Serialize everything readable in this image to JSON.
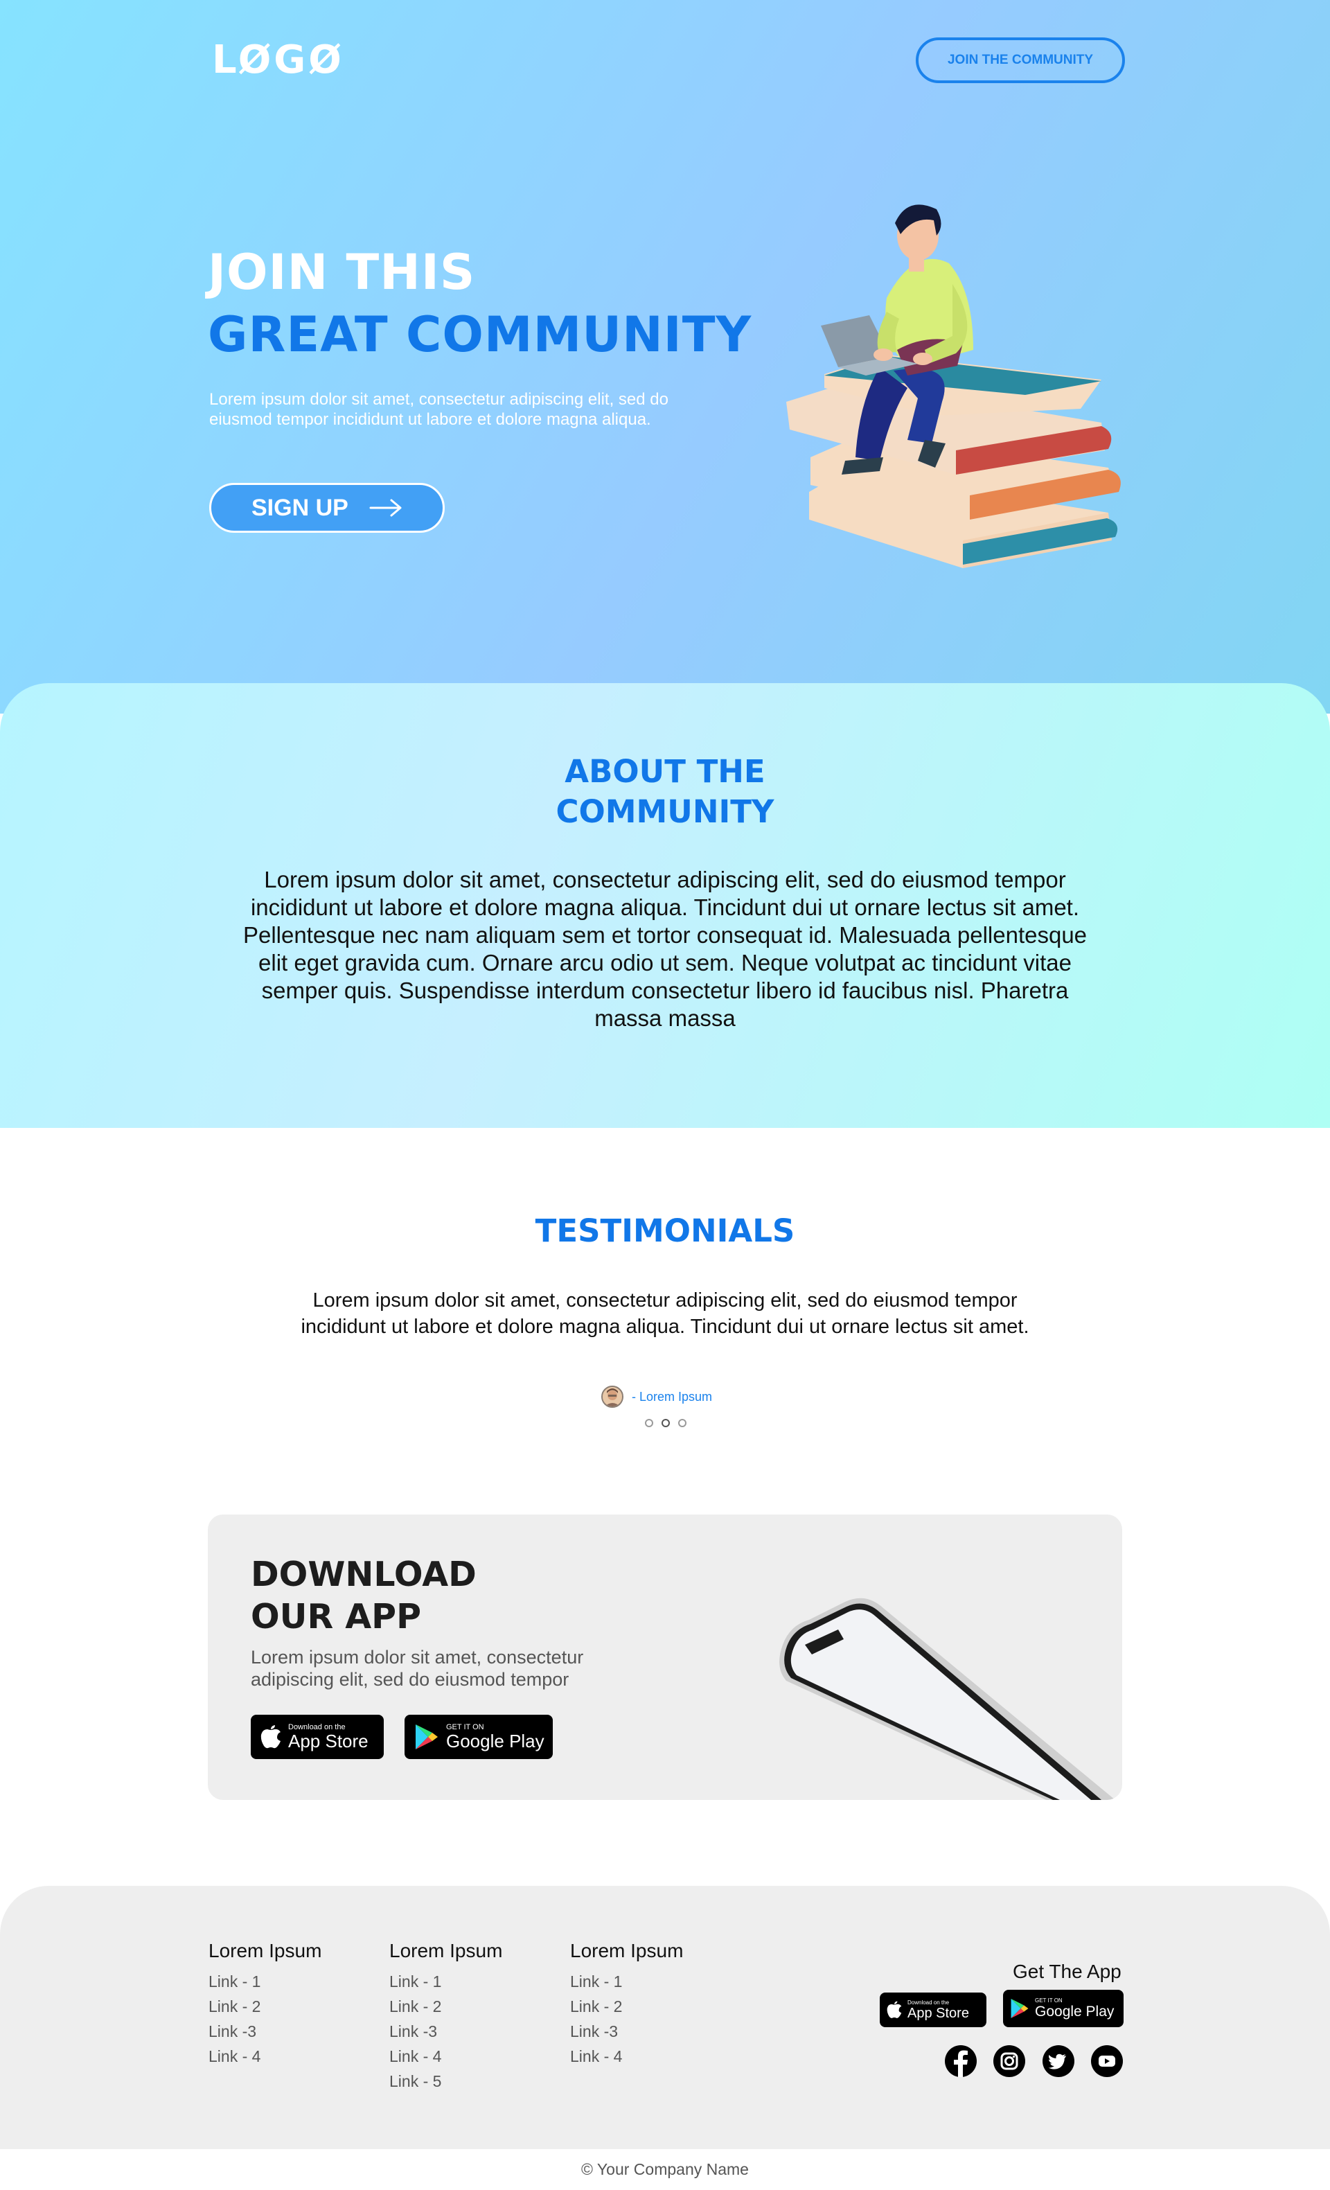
{
  "header": {
    "logo": "LØGØ",
    "join_button": "JOIN THE COMMUNITY"
  },
  "hero": {
    "title_line1": "JOIN THIS",
    "title_line2": "GREAT COMMUNITY",
    "description": "Lorem ipsum dolor sit amet, consectetur adipiscing elit, sed do eiusmod tempor incididunt ut labore et dolore magna aliqua.",
    "signup_label": "SIGN UP",
    "illustration_icon": "person-reading-on-books-illustration"
  },
  "about": {
    "title_line1": "ABOUT THE",
    "title_line2": "COMMUNITY",
    "text": "Lorem ipsum dolor sit amet, consectetur adipiscing elit, sed do eiusmod tempor incididunt ut labore et dolore magna aliqua. Tincidunt dui ut ornare lectus sit amet. Pellentesque nec nam aliquam sem et tortor consequat id. Malesuada pellentesque elit eget gravida cum. Ornare arcu odio ut sem. Neque volutpat ac tincidunt vitae semper quis. Suspendisse interdum consectetur libero id faucibus nisl. Pharetra massa massa"
  },
  "testimonials": {
    "title": "TESTIMONIALS",
    "quote": "Lorem ipsum dolor sit amet, consectetur adipiscing elit, sed do eiusmod tempor incididunt ut labore et dolore magna aliqua. Tincidunt dui ut ornare lectus sit amet.",
    "author": "- Lorem Ipsum",
    "dots_count": 3,
    "active_dot": 2
  },
  "download": {
    "title_line1": "DOWNLOAD",
    "title_line2": "OUR APP",
    "description": "Lorem ipsum dolor sit amet, consectetur adipiscing elit, sed do eiusmod tempor",
    "app_store_small": "Download on the",
    "app_store_big": "App Store",
    "google_play_small": "GET IT ON",
    "google_play_big": "Google Play"
  },
  "footer": {
    "columns": [
      {
        "title": "Lorem Ipsum",
        "links": [
          "Link - 1",
          "Link - 2",
          "Link -3",
          "Link - 4"
        ]
      },
      {
        "title": "Lorem Ipsum",
        "links": [
          "Link - 1",
          "Link - 2",
          "Link -3",
          "Link - 4",
          "Link - 5"
        ]
      },
      {
        "title": "Lorem Ipsum",
        "links": [
          "Link - 1",
          "Link - 2",
          "Link -3",
          "Link - 4"
        ]
      }
    ],
    "get_app": "Get The App",
    "app_store_small": "Download on the",
    "app_store_big": "App Store",
    "google_play_small": "GET IT ON",
    "google_play_big": "Google Play",
    "social_icons": [
      "facebook-icon",
      "instagram-icon",
      "twitter-icon",
      "youtube-icon"
    ],
    "copyright": "© Your Company Name"
  },
  "colors": {
    "accent": "#1177e8",
    "hero_gradient_start": "#86e3ff",
    "hero_gradient_end": "#96cbff",
    "about_gradient": "#aefff4",
    "panel_gray": "#eeeeee"
  }
}
